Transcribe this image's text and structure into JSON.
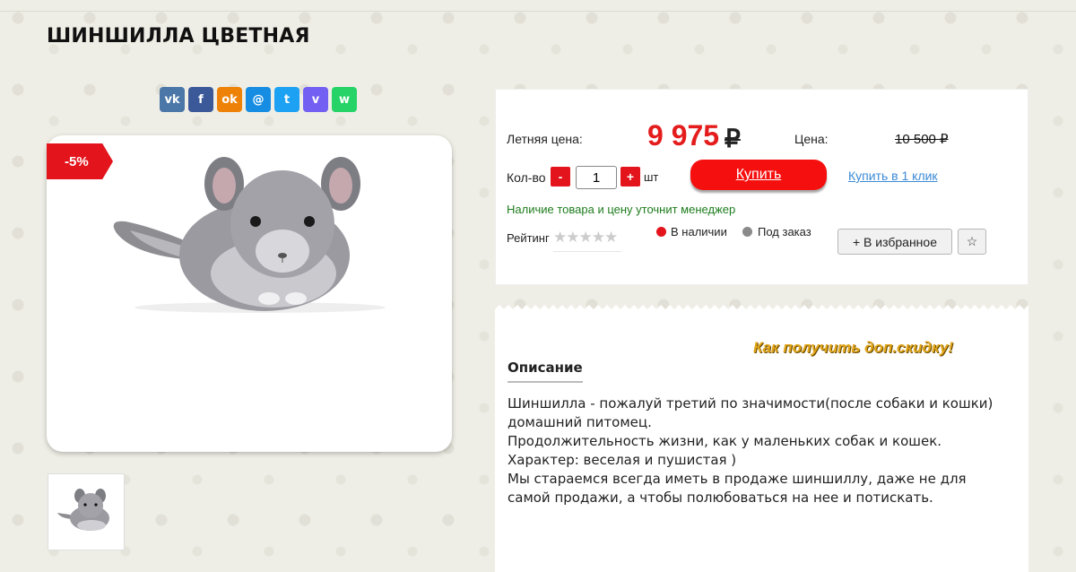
{
  "product": {
    "title": "ШИНШИЛЛА ЦВЕТНАЯ",
    "discount_badge": "-5%"
  },
  "share": [
    {
      "icon": "vk-icon",
      "glyph": "vk",
      "color": "#4a76a8"
    },
    {
      "icon": "facebook-icon",
      "glyph": "f",
      "color": "#3b5998"
    },
    {
      "icon": "odnoklassniki-icon",
      "glyph": "ok",
      "color": "#ee8208"
    },
    {
      "icon": "moimir-icon",
      "glyph": "@",
      "color": "#168de2"
    },
    {
      "icon": "twitter-icon",
      "glyph": "t",
      "color": "#1da1f2"
    },
    {
      "icon": "viber-icon",
      "glyph": "v",
      "color": "#7360f2"
    },
    {
      "icon": "whatsapp-icon",
      "glyph": "w",
      "color": "#25d366"
    }
  ],
  "price": {
    "summer_label": "Летняя цена:",
    "summer_value": "9 975",
    "currency": "₽",
    "regular_label": "Цена:",
    "regular_value": "10 500 ₽"
  },
  "quantity": {
    "label": "Кол-во",
    "minus": "-",
    "value": "1",
    "plus": "+",
    "unit": "шт"
  },
  "actions": {
    "buy": "Купить",
    "one_click": "Купить в 1 клик",
    "favorite": "+ В избранное",
    "star": "☆"
  },
  "availability_note": "Наличие товара и цену уточнит менеджер",
  "rating": {
    "label": "Рейтинг",
    "value": 0,
    "max": 5,
    "stars": "★★★★★"
  },
  "stock_legend": [
    {
      "label": "В наличии",
      "color": "#e3141b"
    },
    {
      "label": "Под заказ",
      "color": "#8a8a8a"
    }
  ],
  "promo_link": "Как получить доп.скидку!",
  "description": {
    "tab": "Описание",
    "lines": [
      "Шиншилла - пожалуй третий по значимости(после собаки и кошки) домашний питомец.",
      "Продолжительность жизни, как у маленьких собак и кошек.",
      "Характер: веселая и пушистая )",
      "Мы стараемся всегда иметь в продаже шиншиллу, даже не для самой продажи, а чтобы полюбоваться на нее и потискать."
    ]
  }
}
